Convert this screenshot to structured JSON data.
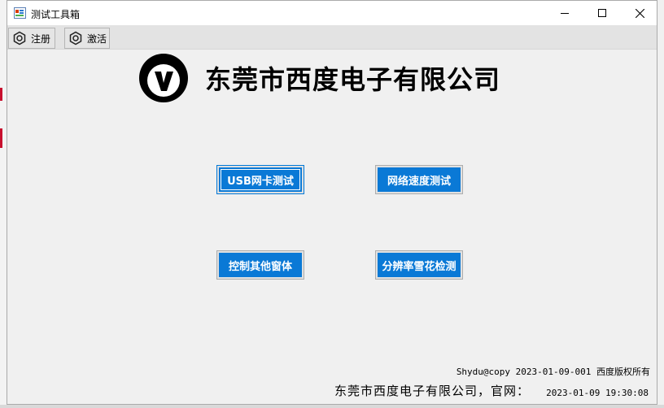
{
  "window": {
    "title": "测试工具箱",
    "controls": {
      "minimize": "minimize-icon",
      "maximize": "maximize-icon",
      "close": "close-icon"
    }
  },
  "toolbar": {
    "register_label": "注册",
    "activate_label": "激活",
    "icon": "gear-icon"
  },
  "header": {
    "company_name": "东莞市西度电子有限公司",
    "logo": "v-circle-logo"
  },
  "buttons": {
    "usb_test": "USB网卡测试",
    "network_speed": "网络速度测试",
    "control_windows": "控制其他窗体",
    "resolution_snow": "分辨率雪花检测"
  },
  "footer": {
    "copyright": "Shydu@copy 2023-01-09-001 西度版权所有",
    "company_site": "东莞市西度电子有限公司，官网：",
    "datetime": "2023-01-09 19:30:08"
  },
  "colors": {
    "button_blue": "#0a79d6",
    "window_bg": "#f0f0f0",
    "toolbar_bg": "#e3e3e3"
  }
}
